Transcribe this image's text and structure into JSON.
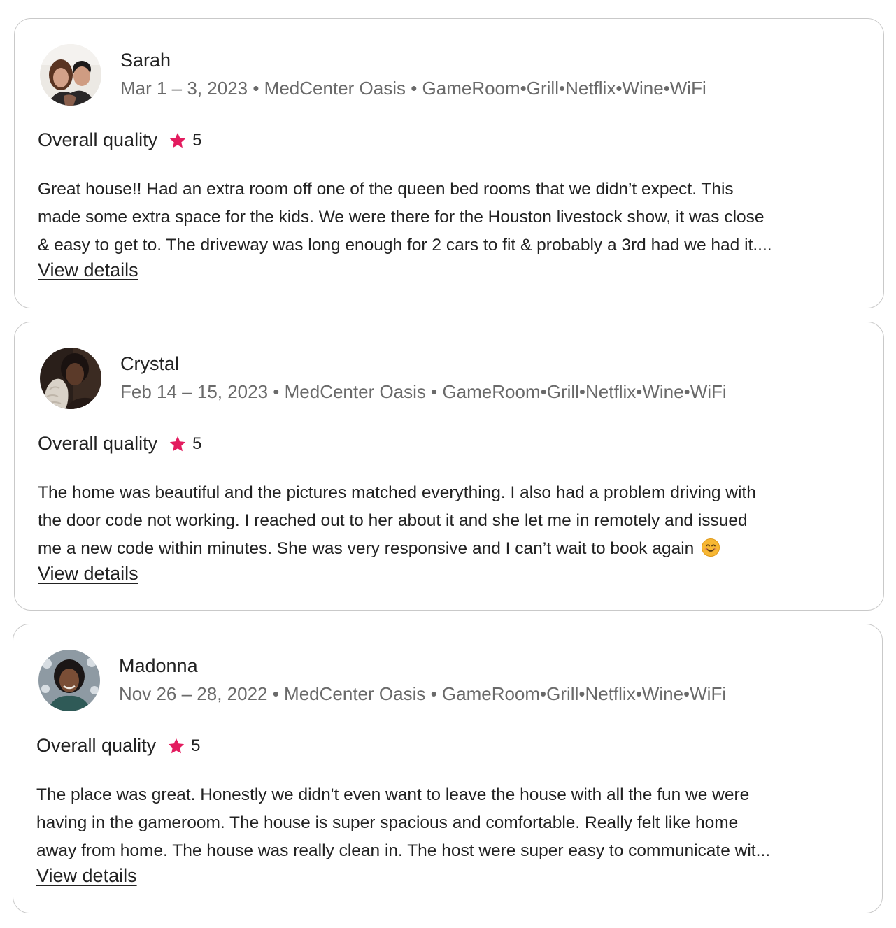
{
  "reviews": [
    {
      "name": "Sarah",
      "stay_meta": "Mar 1 – 3, 2023 • MedCenter Oasis • GameRoom•Grill•Netflix•Wine•WiFi",
      "rating_label": "Overall quality",
      "rating_value": "5",
      "text_lines": [
        "Great house!! Had an extra room off one of the queen bed rooms that we didn’t expect. This",
        "made some extra space for the kids. We were there for the Houston livestock show, it was close",
        "& easy to get to. The driveway was long enough for 2 cars to fit & probably a 3rd had we had it...."
      ],
      "view_details_label": "View details",
      "avatar_icon": "couple-photo-avatar"
    },
    {
      "name": "Crystal",
      "stay_meta": "Feb 14 – 15, 2023 • MedCenter Oasis • GameRoom•Grill•Netflix•Wine•WiFi",
      "rating_label": "Overall quality",
      "rating_value": "5",
      "text_lines": [
        "The home was beautiful and the pictures matched everything. I also had a problem driving with",
        "the door code not working. I reached out to her about it and she let me in remotely and issued",
        "me a new code within minutes. She was very responsive and I can’t wait to book again"
      ],
      "view_details_label": "View details",
      "avatar_icon": "woman-photo-avatar",
      "emoji_icon": "smiling-face-emoji"
    },
    {
      "name": "Madonna",
      "stay_meta": "Nov 26 – 28, 2022 • MedCenter Oasis • GameRoom•Grill•Netflix•Wine•WiFi",
      "rating_label": "Overall quality",
      "rating_value": "5",
      "text_lines": [
        "The place was great. Honestly we didn't even want to leave the house with all the fun we were",
        "having in the gameroom. The house is super spacious and comfortable. Really felt like home",
        "away from home. The house was really clean in. The host were super easy to communicate wit..."
      ],
      "view_details_label": "View details",
      "avatar_icon": "woman-photo-avatar"
    }
  ],
  "colors": {
    "star": "#e31c5f",
    "text": "#222222",
    "meta": "#6a6a6a",
    "border": "#c9c9c9"
  }
}
